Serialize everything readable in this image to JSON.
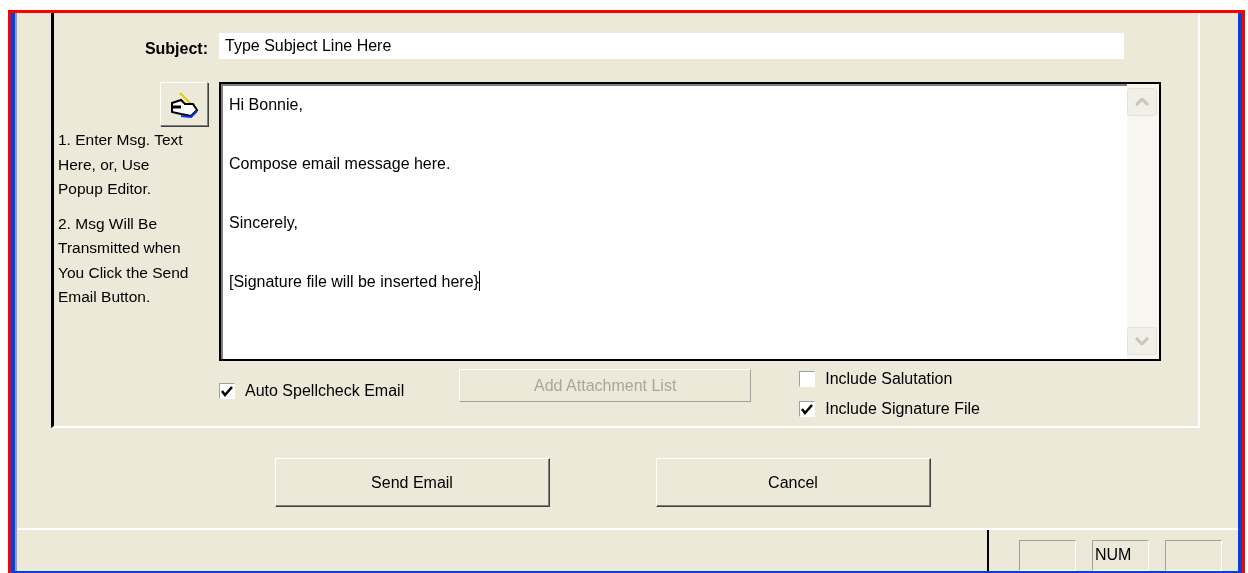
{
  "subject": {
    "label": "Subject:",
    "value": "Type Subject Line Here"
  },
  "instructions": [
    "1. Enter Msg. Text Here, or, Use Popup Editor.",
    "2. Msg Will Be Transmitted when You Click the Send Email Button."
  ],
  "message": {
    "paragraphs": [
      "Hi Bonnie,",
      "Compose email message here.",
      "Sincerely,",
      "[Signature file will be inserted here}"
    ],
    "cursor": true
  },
  "options": [
    {
      "kind": "checkbox",
      "label": "Auto Spellcheck Email",
      "checked": true
    },
    {
      "kind": "button",
      "label": "Add Attachment List",
      "disabled": true
    },
    {
      "kind": "checkbox",
      "label": "Include Salutation",
      "checked": false
    },
    {
      "kind": "checkbox",
      "label": "Include Signature File",
      "checked": true
    }
  ],
  "buttons": [
    {
      "label": "Send Email"
    },
    {
      "label": "Cancel"
    }
  ],
  "status_bar": {
    "num_indicator": "NUM"
  }
}
